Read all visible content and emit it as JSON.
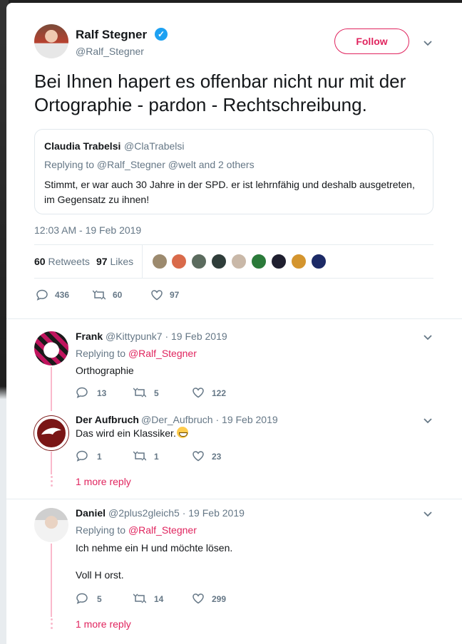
{
  "tweet": {
    "author_name": "Ralf Stegner",
    "author_handle": "@Ralf_Stegner",
    "follow_label": "Follow",
    "text": "Bei Ihnen hapert es offenbar nicht nur mit der Ortographie - pardon - Rechtschreibung.",
    "quote": {
      "name": "Claudia Trabelsi",
      "handle": "@ClaTrabelsi",
      "replying_to": "Replying to @Ralf_Stegner @welt and 2 others",
      "text": "Stimmt, er war auch 30 Jahre in der SPD. er ist lehrnfähig und deshalb ausgetreten, im Gegensatz zu ihnen!"
    },
    "timestamp": "12:03 AM - 19 Feb 2019",
    "retweets_count": "60",
    "retweets_label": "Retweets",
    "likes_count": "97",
    "likes_label": "Likes",
    "actions": {
      "replies": "436",
      "retweets": "60",
      "likes": "97"
    }
  },
  "replies": [
    {
      "name": "Frank",
      "meta": "@Kittypunk7 · 19 Feb 2019",
      "replying_prefix": "Replying to ",
      "replying_handle": "@Ralf_Stegner",
      "text": "Orthographie",
      "replies": "13",
      "retweets": "5",
      "likes": "122"
    },
    {
      "name": "Der Aufbruch",
      "meta": "@Der_Aufbruch · 19 Feb 2019",
      "text": "Das wird ein Klassiker.",
      "replies": "1",
      "retweets": "1",
      "likes": "23",
      "more_reply": "1 more reply"
    },
    {
      "name": "Daniel",
      "meta": "@2plus2gleich5 · 19 Feb 2019",
      "replying_prefix": "Replying to ",
      "replying_handle": "@Ralf_Stegner",
      "text_line1": "Ich nehme ein H und möchte lösen.",
      "text_line2": "Voll H orst.",
      "replies": "5",
      "retweets": "14",
      "likes": "299",
      "more_reply": "1 more reply"
    }
  ],
  "colors": {
    "accent": "#e0245e",
    "thread": "#fab9cc",
    "muted": "#657786",
    "verified": "#1da1f2"
  },
  "icons": [
    "verified-icon",
    "chevron-down-icon",
    "reply-icon",
    "retweet-icon",
    "like-icon",
    "smile-emoji-icon"
  ]
}
